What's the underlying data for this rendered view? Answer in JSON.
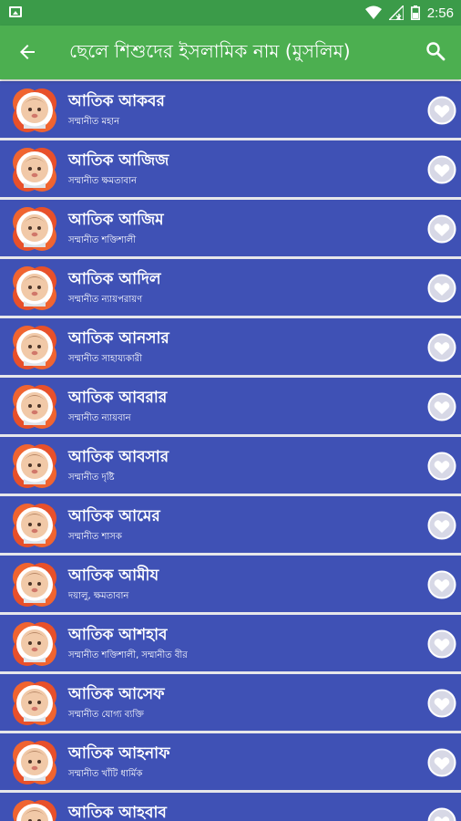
{
  "status_bar": {
    "time": "2:56",
    "icons": [
      "image-notification-icon",
      "wifi-icon",
      "signal-icon",
      "battery-icon"
    ]
  },
  "app_bar": {
    "title": "ছেলে শিশুদের ইসলামিক নাম (মুসলিম)",
    "back_icon": "arrow-left-icon",
    "search_icon": "search-icon",
    "color": "#4caf50",
    "status_color": "#3b9b49"
  },
  "list": {
    "row_color": "#3f51b5",
    "divider_color": "#e6e6ea",
    "items": [
      {
        "name": "আতিক আকবর",
        "meaning": "সম্মানীত মহান"
      },
      {
        "name": "আতিক আজিজ",
        "meaning": "সম্মানীত ক্ষমতাবান"
      },
      {
        "name": "আতিক আজিম",
        "meaning": "সম্মানীত শক্তিশালী"
      },
      {
        "name": "আতিক আদিল",
        "meaning": "সম্মানীত ন্যায়পরায়ণ"
      },
      {
        "name": "আতিক আনসার",
        "meaning": "সম্মানীত সাহায্যকারী"
      },
      {
        "name": "আতিক আবরার",
        "meaning": "সম্মানীত ন্যায়বান"
      },
      {
        "name": "আতিক আবসার",
        "meaning": "সম্মানীত দৃষ্টি"
      },
      {
        "name": "আতিক আমের",
        "meaning": "সম্মানীত শাসক"
      },
      {
        "name": "আতিক আমীয",
        "meaning": "দয়ালু, ক্ষমতাবান"
      },
      {
        "name": "আতিক আশহাব",
        "meaning": "সম্মানীত শক্তিশালী, সম্মানীত বীর"
      },
      {
        "name": "আতিক আসেফ",
        "meaning": "সম্মানীত যোগ্য ব্যক্তি"
      },
      {
        "name": "আতিক আহনাফ",
        "meaning": "সম্মানীত খাঁটি ধার্মিক"
      },
      {
        "name": "আতিক আহবাব",
        "meaning": ""
      }
    ]
  }
}
